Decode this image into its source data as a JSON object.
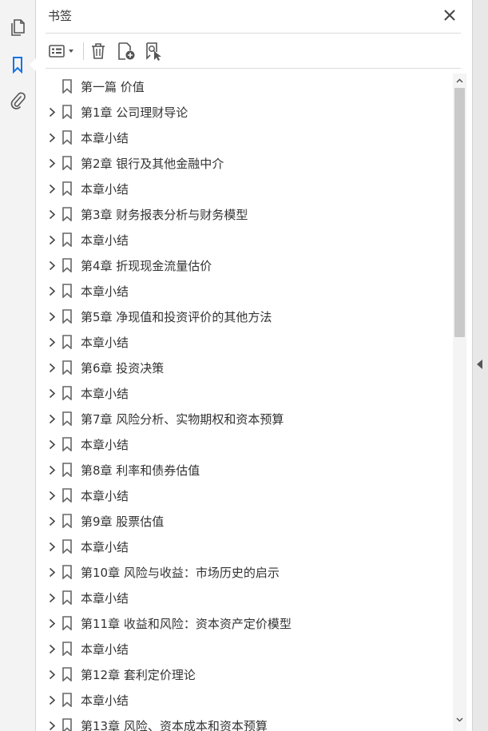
{
  "panel": {
    "title": "书签",
    "colors": {
      "accent": "#1473e6",
      "icon": "#555555"
    }
  },
  "left_rail": {
    "items": [
      {
        "icon": "pages-icon"
      },
      {
        "icon": "bookmark-icon",
        "active": true
      },
      {
        "icon": "attachment-icon"
      }
    ]
  },
  "toolbar": {
    "items": [
      {
        "icon": "options-menu-icon"
      },
      {
        "icon": "delete-icon"
      },
      {
        "icon": "new-bookmark-icon"
      },
      {
        "icon": "find-bookmark-icon"
      }
    ]
  },
  "bookmarks": [
    {
      "label": "第一篇  价值",
      "expandable": false
    },
    {
      "label": "第1章  公司理财导论",
      "expandable": true
    },
    {
      "label": "本章小结",
      "expandable": true
    },
    {
      "label": "第2章  银行及其他金融中介",
      "expandable": true
    },
    {
      "label": "本章小结",
      "expandable": true
    },
    {
      "label": "第3章  财务报表分析与财务模型",
      "expandable": true
    },
    {
      "label": "本章小结",
      "expandable": true
    },
    {
      "label": "第4章  折现现金流量估价",
      "expandable": true
    },
    {
      "label": "本章小结",
      "expandable": true
    },
    {
      "label": "第5章  净现值和投资评价的其他方法",
      "expandable": true
    },
    {
      "label": "本章小结",
      "expandable": true
    },
    {
      "label": "第6章  投资决策",
      "expandable": true
    },
    {
      "label": "本章小结",
      "expandable": true
    },
    {
      "label": "第7章  风险分析、实物期权和资本预算",
      "expandable": true
    },
    {
      "label": "本章小结",
      "expandable": true
    },
    {
      "label": "第8章  利率和债券估值",
      "expandable": true
    },
    {
      "label": "本章小结",
      "expandable": true
    },
    {
      "label": "第9章  股票估值",
      "expandable": true
    },
    {
      "label": "本章小结",
      "expandable": true
    },
    {
      "label": "第10章  风险与收益：市场历史的启示",
      "expandable": true
    },
    {
      "label": "本章小结",
      "expandable": true
    },
    {
      "label": "第11章  收益和风险：资本资产定价模型",
      "expandable": true
    },
    {
      "label": "本章小结",
      "expandable": true
    },
    {
      "label": "第12章  套利定价理论",
      "expandable": true
    },
    {
      "label": "本章小结",
      "expandable": true
    },
    {
      "label": "第13章  风险、资本成本和资本预算",
      "expandable": true
    }
  ]
}
